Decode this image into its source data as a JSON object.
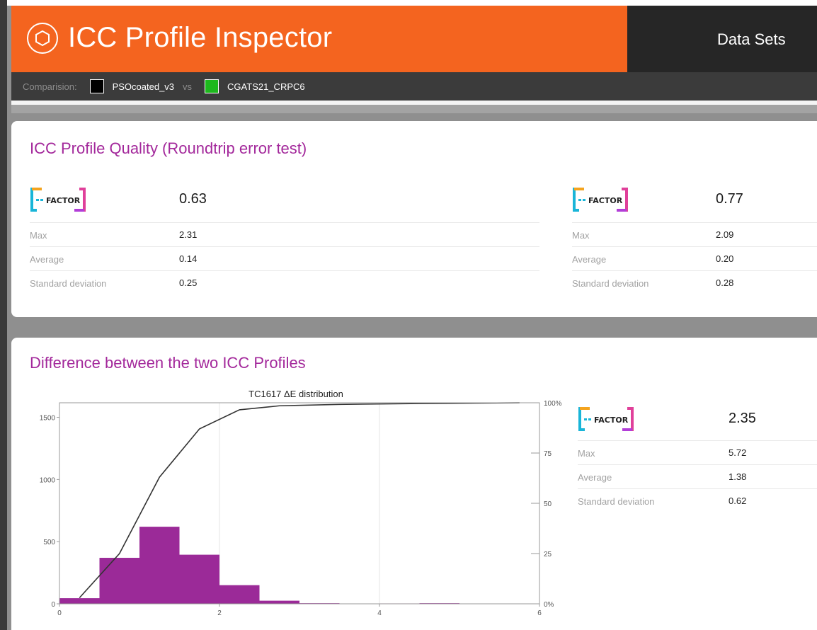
{
  "app": {
    "title": "ICC Profile Inspector"
  },
  "nav": {
    "data_sets": "Data Sets"
  },
  "comparison": {
    "label": "Comparision:",
    "profile_a": {
      "name": "PSOcoated_v3",
      "color": "#000000"
    },
    "vs": "vs",
    "profile_b": {
      "name": "CGATS21_CRPC6",
      "color": "#1db81d"
    }
  },
  "quality": {
    "title": "ICC Profile Quality (Roundtrip error test)",
    "left": {
      "badge": "FACTOR",
      "value": "0.63",
      "rows": [
        {
          "label": "Max",
          "value": "2.31"
        },
        {
          "label": "Average",
          "value": "0.14"
        },
        {
          "label": "Standard deviation",
          "value": "0.25"
        }
      ]
    },
    "right": {
      "badge": "FACTOR",
      "value": "0.77",
      "rows": [
        {
          "label": "Max",
          "value": "2.09"
        },
        {
          "label": "Average",
          "value": "0.20"
        },
        {
          "label": "Standard deviation",
          "value": "0.28"
        }
      ]
    }
  },
  "difference": {
    "title": "Difference between the two ICC Profiles",
    "stats": {
      "badge": "FACTOR",
      "value": "2.35",
      "rows": [
        {
          "label": "Max",
          "value": "5.72"
        },
        {
          "label": "Average",
          "value": "1.38"
        },
        {
          "label": "Standard deviation",
          "value": "0.62"
        }
      ]
    }
  },
  "colors": {
    "accent": "#f4641f",
    "title_purple": "#a3289b",
    "bar_purple": "#9b2a98",
    "dark": "#262626"
  },
  "chart_data": {
    "type": "bar",
    "title": "TC1617 ΔE distribution",
    "x_ticks": [
      "0",
      "2",
      "4",
      "6"
    ],
    "xlim": [
      0,
      6
    ],
    "y_ticks": [
      "0",
      "500",
      "1000",
      "1500"
    ],
    "ylim": [
      0,
      1617
    ],
    "y2_ticks": [
      "0%",
      "25",
      "50",
      "75",
      "100%"
    ],
    "y2lim": [
      0,
      100
    ],
    "bin_width": 0.5,
    "bins_x0": [
      0,
      0.5,
      1.0,
      1.5,
      2.0,
      2.5,
      3.0,
      3.5,
      4.0,
      4.5,
      5.0,
      5.5
    ],
    "values": [
      45,
      370,
      620,
      395,
      150,
      25,
      5,
      2,
      3,
      5,
      2,
      0
    ],
    "cumulative": {
      "x": [
        0.25,
        0.75,
        1.25,
        1.75,
        2.25,
        2.75,
        3.5,
        4.5,
        5.75
      ],
      "y": [
        3,
        25,
        63,
        87,
        96.5,
        98.5,
        99.2,
        99.6,
        100
      ]
    },
    "grid": true
  }
}
